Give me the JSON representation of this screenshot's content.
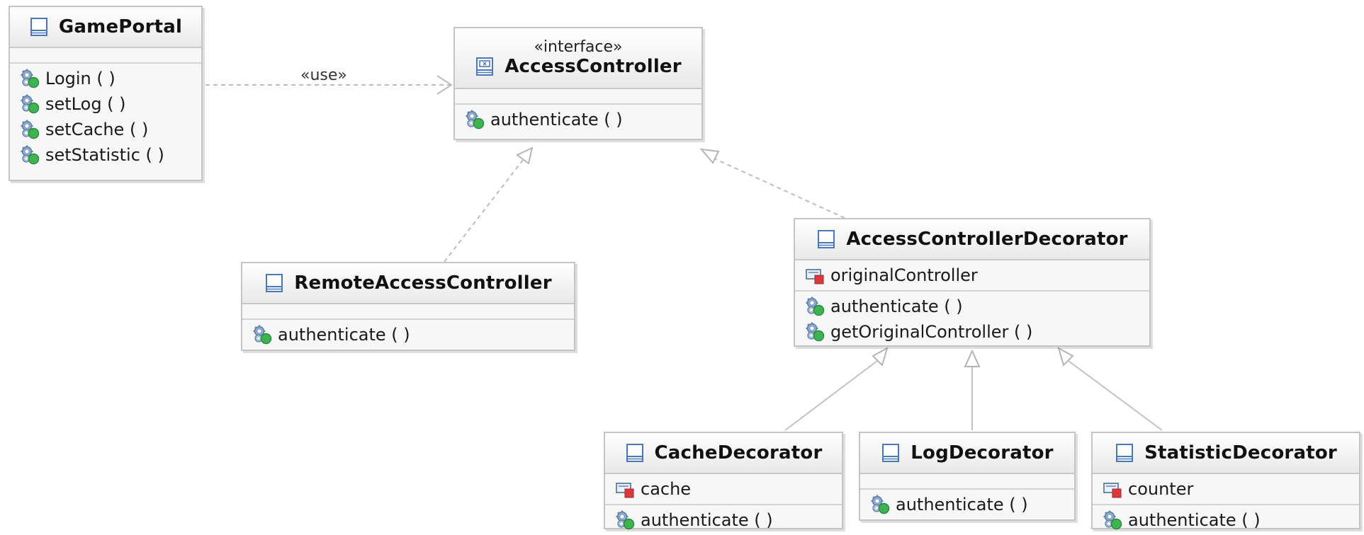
{
  "classes": {
    "game_portal": {
      "name": "GamePortal",
      "methods": [
        "Login ( )",
        "setLog ( )",
        "setCache ( )",
        "setStatistic ( )"
      ]
    },
    "access_controller": {
      "stereotype": "«interface»",
      "name": "AccessController",
      "methods": [
        "authenticate ( )"
      ]
    },
    "remote_access_controller": {
      "name": "RemoteAccessController",
      "methods": [
        "authenticate ( )"
      ]
    },
    "access_controller_decorator": {
      "name": "AccessControllerDecorator",
      "attributes": [
        "originalController"
      ],
      "methods": [
        "authenticate ( )",
        "getOriginalController ( )"
      ]
    },
    "cache_decorator": {
      "name": "CacheDecorator",
      "attributes": [
        "cache"
      ],
      "methods": [
        "authenticate ( )"
      ]
    },
    "log_decorator": {
      "name": "LogDecorator",
      "methods": [
        "authenticate ( )"
      ]
    },
    "statistic_decorator": {
      "name": "StatisticDecorator",
      "attributes": [
        "counter"
      ],
      "methods": [
        "authenticate ( )"
      ]
    }
  },
  "relations": {
    "use_label": "«use»"
  },
  "colors": {
    "box_fill": "#f7f7f7",
    "box_border": "#c4c4c4",
    "connector": "#b5b5b5",
    "class_icon": "#4a78b8",
    "method_icon_gear": "#5c7fa8",
    "method_icon_public": "#38a84c",
    "attribute_icon_private": "#d83a3a"
  },
  "icons": {
    "class": "class-icon",
    "interface": "interface-icon",
    "method": "public-method-gear-icon",
    "attribute": "private-field-icon"
  }
}
